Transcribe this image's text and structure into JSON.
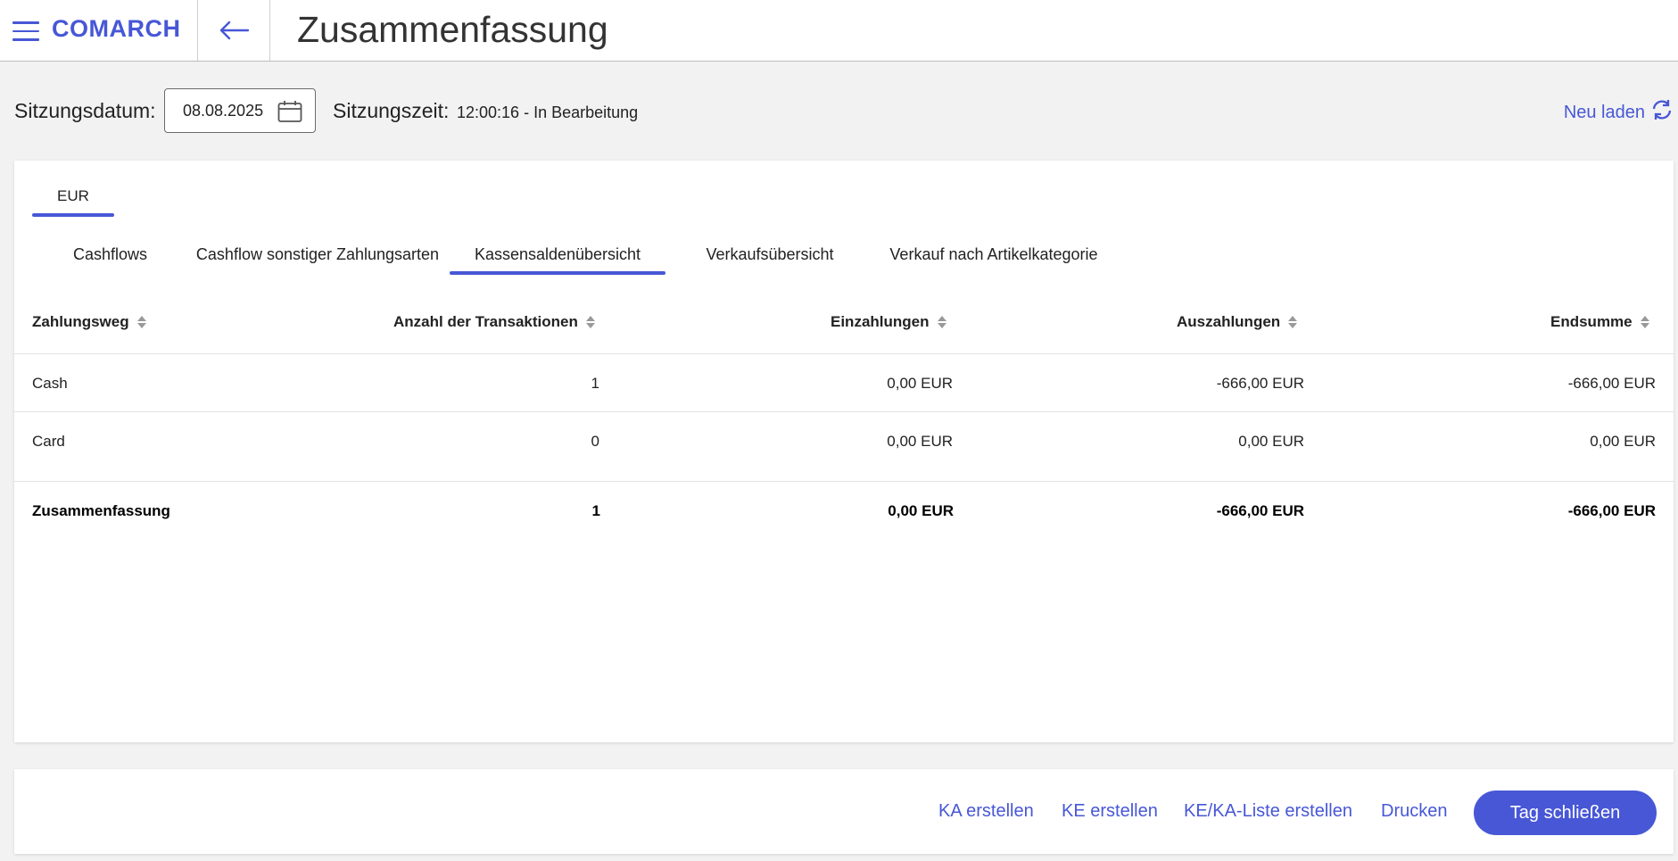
{
  "header": {
    "logo": "COMARCH",
    "title": "Zusammenfassung"
  },
  "session": {
    "date_label": "Sitzungsdatum:",
    "date_value": "08.08.2025",
    "time_label": "Sitzungszeit:",
    "time_value": "12:00:16 - In Bearbeitung",
    "reload_label": "Neu laden"
  },
  "currency_tabs": [
    {
      "label": "EUR",
      "active": true
    }
  ],
  "tabs": [
    {
      "label": "Cashflows",
      "active": false
    },
    {
      "label": "Cashflow sonstiger Zahlungsarten",
      "active": false
    },
    {
      "label": "Kassensaldenübersicht",
      "active": true
    },
    {
      "label": "Verkaufsübersicht",
      "active": false
    },
    {
      "label": "Verkauf nach Artikelkategorie",
      "active": false
    }
  ],
  "table": {
    "columns": [
      "Zahlungsweg",
      "Anzahl der Transaktionen",
      "Einzahlungen",
      "Auszahlungen",
      "Endsumme"
    ],
    "rows": [
      [
        "Cash",
        "1",
        "0,00 EUR",
        "-666,00 EUR",
        "-666,00 EUR"
      ],
      [
        "Card",
        "0",
        "0,00 EUR",
        "0,00 EUR",
        "0,00 EUR"
      ]
    ],
    "summary": [
      "Zusammenfassung",
      "1",
      "0,00 EUR",
      "-666,00 EUR",
      "-666,00 EUR"
    ]
  },
  "footer": {
    "ka": "KA erstellen",
    "ke": "KE erstellen",
    "list": "KE/KA-Liste erstellen",
    "print": "Drucken",
    "close_day": "Tag schließen"
  },
  "colors": {
    "accent": "#4757d6",
    "background": "#f2f2f2"
  }
}
